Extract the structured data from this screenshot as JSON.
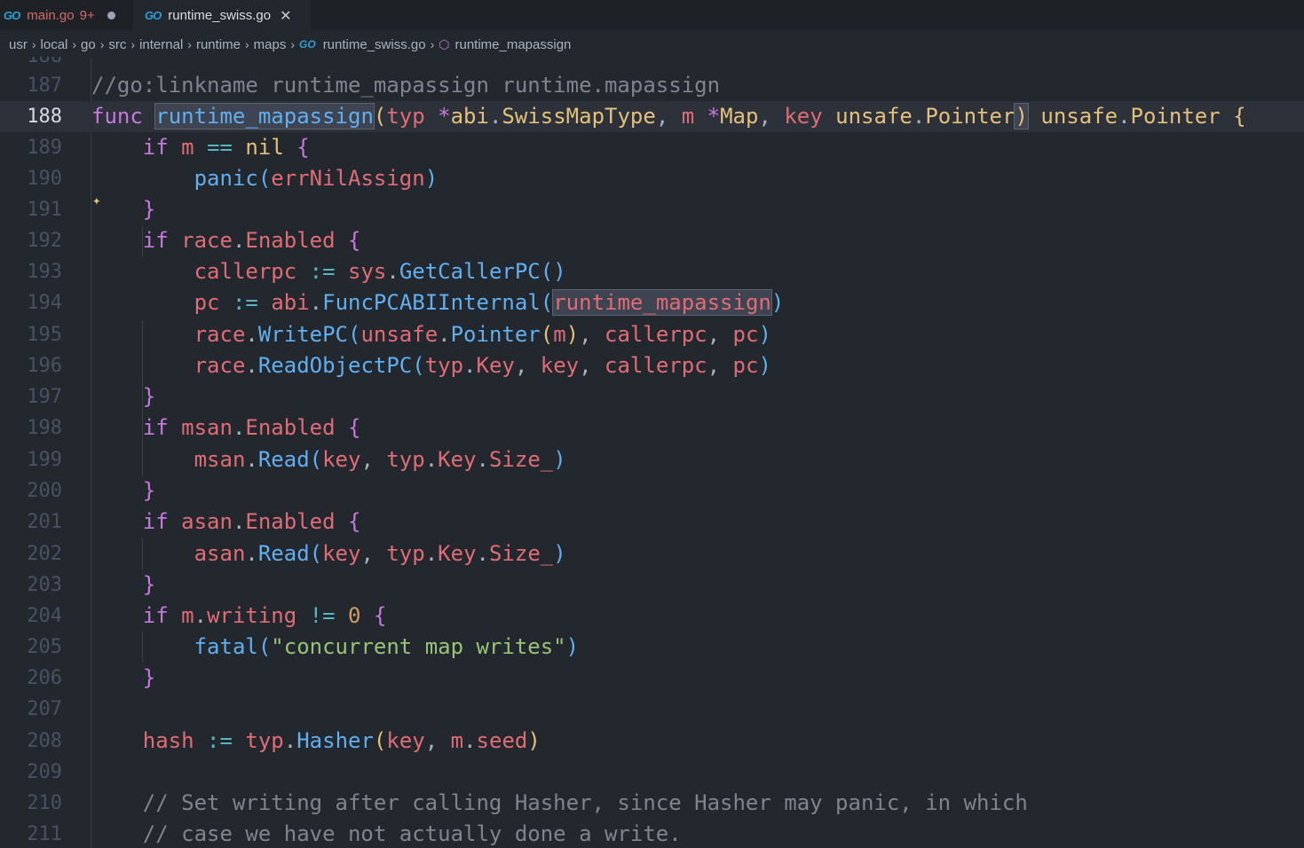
{
  "tabs": [
    {
      "label": "main.go",
      "badge": "9+",
      "icon": "go-icon",
      "active": false
    },
    {
      "label": "runtime_swiss.go",
      "icon": "go-icon",
      "active": true
    }
  ],
  "breadcrumb": [
    "usr",
    "local",
    "go",
    "src",
    "internal",
    "runtime",
    "maps",
    "runtime_swiss.go",
    "runtime_mapassign"
  ],
  "line_numbers": [
    "187",
    "188",
    "189",
    "190",
    "191",
    "192",
    "193",
    "194",
    "195",
    "196",
    "197",
    "198",
    "199",
    "200",
    "201",
    "202",
    "203",
    "204",
    "205",
    "206",
    "207",
    "208",
    "209",
    "210",
    "211"
  ],
  "code": {
    "l187": "//go:linkname runtime_mapassign runtime.mapassign",
    "l188_func": "func",
    "l188_name": "runtime_mapassign",
    "l188_typ": "typ",
    "l188_abi": "abi",
    "l188_smt": "SwissMapType",
    "l188_m": "m",
    "l188_map": "Map",
    "l188_key": "key",
    "l188_unsafe": "unsafe",
    "l188_ptr": "Pointer",
    "l190": "errNilAssign",
    "l205_str": "\"concurrent map writes\"",
    "l210": "// Set writing after calling Hasher, since Hasher may panic, in which",
    "l211": "// case we have not actually done a write."
  },
  "colors": {
    "background": "#23272e",
    "keyword": "#c678dd",
    "variable": "#e06c75",
    "function": "#61afef",
    "type": "#e5c07b"
  }
}
